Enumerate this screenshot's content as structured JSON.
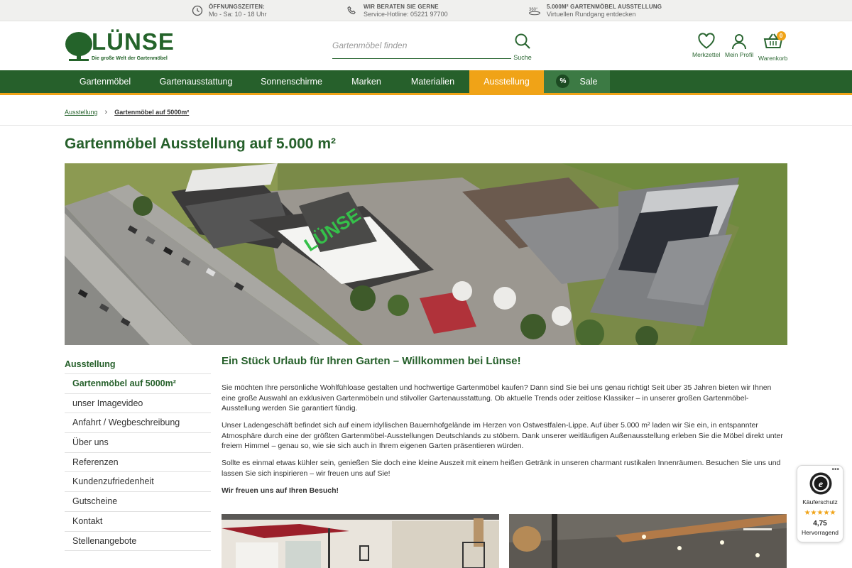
{
  "topbar": {
    "hours": {
      "title": "ÖFFNUNGSZEITEN:",
      "text": "Mo - Sa: 10 - 18 Uhr",
      "icon": "clock-icon"
    },
    "advice": {
      "title": "WIR BERATEN SIE GERNE",
      "text": "Service-Hotline: 05221 97700",
      "icon": "phone-icon"
    },
    "tour": {
      "badge": "360°",
      "title": "5.000m² GARTENMÖBEL AUSSTELLUNG",
      "text": "Virtuellen Rundgang entdecken",
      "icon": "360-icon"
    }
  },
  "header": {
    "logo_word": "LÜNSE",
    "logo_tagline": "Die große Welt der Gartenmöbel",
    "search_placeholder": "Gartenmöbel finden",
    "search_label": "Suche",
    "wishlist_label": "Merkzettel",
    "profile_label": "Mein Profil",
    "cart_label": "Warenkorb",
    "cart_count": "0"
  },
  "nav": {
    "items": [
      {
        "label": "Gartenmöbel"
      },
      {
        "label": "Gartenausstattung"
      },
      {
        "label": "Sonnenschirme"
      },
      {
        "label": "Marken"
      },
      {
        "label": "Materialien"
      },
      {
        "label": "Ausstellung"
      },
      {
        "label": "Sale",
        "badge": "%"
      }
    ],
    "active_color": "#f0a317",
    "bar_color": "#26602b"
  },
  "breadcrumb": {
    "items": [
      "Ausstellung",
      "Gartenmöbel auf 5000m²"
    ]
  },
  "page": {
    "title": "Gartenmöbel Ausstellung auf 5.000 m²"
  },
  "sidebar": {
    "heading": "Ausstellung",
    "links": [
      "Gartenmöbel auf 5000m²",
      "unser Imagevideo",
      "Anfahrt / Wegbeschreibung",
      "Über uns",
      "Referenzen",
      "Kundenzufriedenheit",
      "Gutscheine",
      "Kontakt",
      "Stellenangebote"
    ]
  },
  "content": {
    "heading": "Ein Stück Urlaub für Ihren Garten – Willkommen bei Lünse!",
    "paragraphs": [
      "Sie möchten Ihre persönliche Wohlfühloase gestalten und hochwertige Gartenmöbel kaufen? Dann sind Sie bei uns genau richtig! Seit über 35 Jahren bieten wir Ihnen eine große Auswahl an exklusiven Gartenmöbeln und stilvoller Gartenausstattung. Ob aktuelle Trends oder zeitlose Klassiker – in unserer großen Gartenmöbel-Ausstellung werden Sie garantiert fündig.",
      "Unser Ladengeschäft befindet sich auf einem idyllischen Bauernhofgelände im Herzen von Ostwestfalen-Lippe. Auf über 5.000 m² laden wir Sie ein, in entspannter Atmosphäre durch eine der größten Gartenmöbel-Ausstellungen Deutschlands zu stöbern. Dank unserer weitläufigen Außenausstellung erleben Sie die Möbel direkt unter freiem Himmel – genau so, wie sie sich auch in Ihrem eigenen Garten präsentieren würden.",
      "Sollte es einmal etwas kühler sein, genießen Sie doch eine kleine Auszeit mit einem heißen Getränk in unseren charmant rustikalen Innenräumen. Besuchen Sie uns und lassen Sie sich inspirieren – wir freuen uns auf Sie!"
    ],
    "closing": "Wir freuen uns auf Ihren Besuch!"
  },
  "trust": {
    "label": "Käuferschutz",
    "stars": "★★★★★",
    "score": "4,75",
    "rating": "Hervorragend",
    "menu": "•••"
  }
}
